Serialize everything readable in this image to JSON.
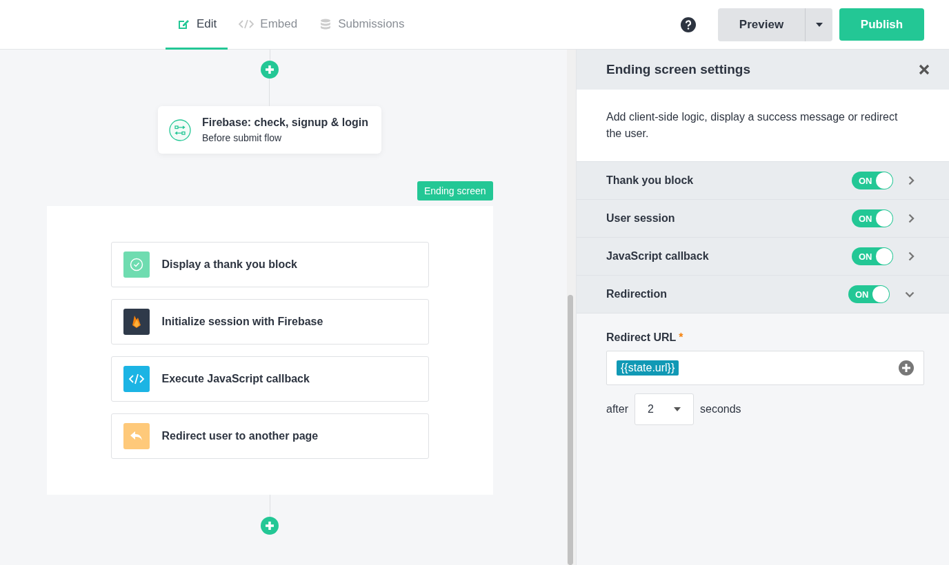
{
  "tabs": [
    {
      "label": "Edit",
      "kind": "edit",
      "selected": true
    },
    {
      "label": "Embed",
      "kind": "embed",
      "selected": false
    },
    {
      "label": "Submissions",
      "kind": "submissions",
      "selected": false
    }
  ],
  "header_buttons": {
    "preview": "Preview",
    "publish": "Publish"
  },
  "canvas": {
    "flow_node": {
      "title": "Firebase: check, signup & login",
      "subtitle": "Before submit flow"
    },
    "ending_badge": "Ending screen",
    "actions": [
      {
        "label": "Display a thank you block",
        "kind": "check"
      },
      {
        "label": "Initialize session with Firebase",
        "kind": "firebase"
      },
      {
        "label": "Execute JavaScript callback",
        "kind": "code"
      },
      {
        "label": "Redirect user to another page",
        "kind": "redirect"
      }
    ]
  },
  "panel": {
    "title": "Ending screen settings",
    "description": "Add client-side logic, display a success message or redirect the user.",
    "sections": [
      {
        "label": "Thank you block",
        "on": true,
        "toggle_label": "ON",
        "expanded": false
      },
      {
        "label": "User session",
        "on": true,
        "toggle_label": "ON",
        "expanded": false
      },
      {
        "label": "JavaScript callback",
        "on": true,
        "toggle_label": "ON",
        "expanded": false
      },
      {
        "label": "Redirection",
        "on": true,
        "toggle_label": "ON",
        "expanded": true
      }
    ],
    "redirect": {
      "label": "Redirect URL",
      "required_mark": "*",
      "value_token": "{{state.url}}",
      "after_label": "after",
      "seconds_value": "2",
      "seconds_label": "seconds"
    }
  }
}
